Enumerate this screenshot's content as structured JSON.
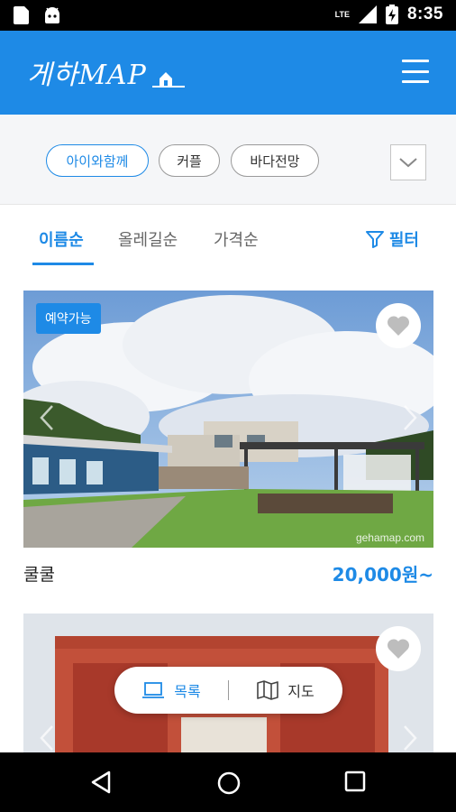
{
  "status_bar": {
    "network": "LTE",
    "time": "8:35"
  },
  "app_bar": {
    "logo_text": "게하MAP",
    "menu_icon": "hamburger-icon"
  },
  "chips": [
    {
      "label": "아이와함께",
      "active": true
    },
    {
      "label": "커플",
      "active": false
    },
    {
      "label": "바다전망",
      "active": false
    }
  ],
  "sort_tabs": [
    {
      "label": "이름순",
      "active": true
    },
    {
      "label": "올레길순",
      "active": false
    },
    {
      "label": "가격순",
      "active": false
    }
  ],
  "filter": {
    "label": "필터",
    "icon": "funnel-icon"
  },
  "listings": [
    {
      "badge": "예약가능",
      "name": "쿨쿨",
      "price": "20,000원~",
      "watermark": "gehamap.com"
    },
    {
      "name": "",
      "price": ""
    }
  ],
  "view_toggle": {
    "list_label": "목록",
    "map_label": "지도"
  },
  "colors": {
    "primary": "#1e8ae6",
    "chip_bg": "#f5f6f8"
  }
}
